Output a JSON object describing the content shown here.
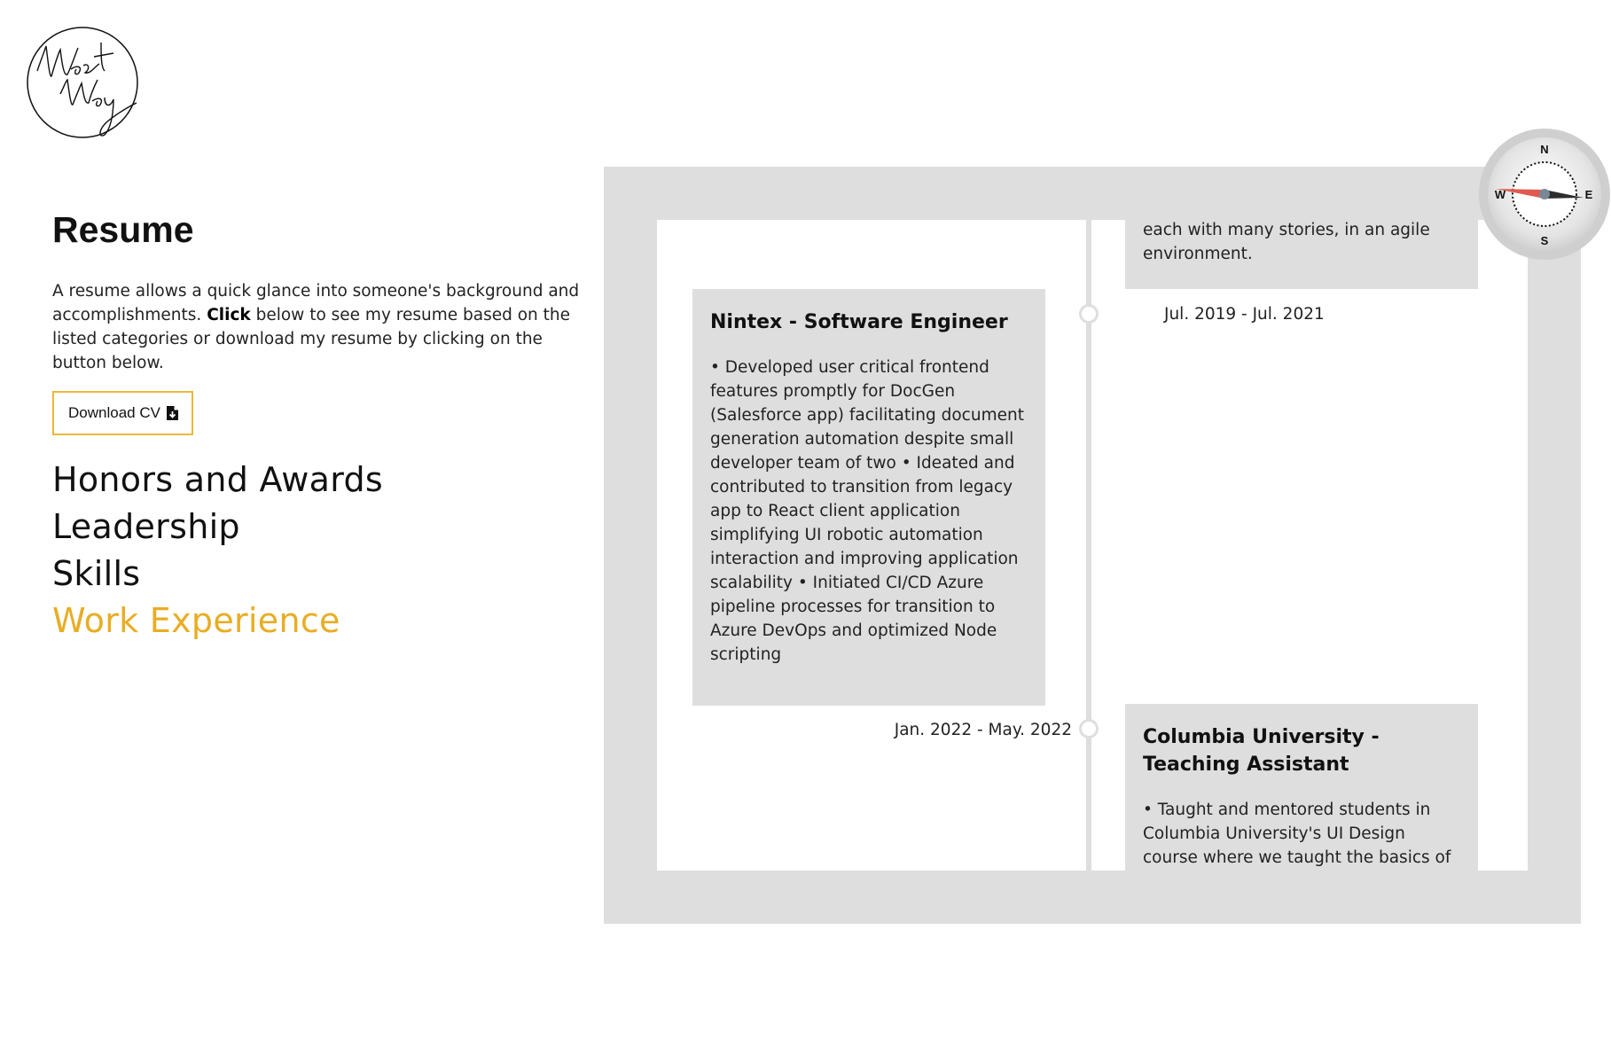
{
  "logo": {
    "alt": "West Way signature logo"
  },
  "resume": {
    "title": "Resume",
    "intro_before": "A resume allows a quick glance into someone's background and accomplishments. ",
    "intro_bold": "Click",
    "intro_after": " below to see my resume based on the listed categories or download my resume by clicking on the button below.",
    "download_label": "Download CV",
    "download_icon": "file-download-icon",
    "categories": [
      "Honors and Awards",
      "Leadership",
      "Skills",
      "Work Experience"
    ],
    "active_category": "Work Experience"
  },
  "timeline": {
    "top_card_text": "each with many stories, in an agile environment.",
    "entries": [
      {
        "title": "Nintex - Software Engineer",
        "date": "Jul. 2019 - Jul. 2021",
        "text": "• Developed user critical frontend features promptly for DocGen (Salesforce app) facilitating document generation automation despite small developer team of two • Ideated and contributed to transition from legacy app to React client application simplifying UI robotic automation interaction and improving application scalability • Initiated CI/CD Azure pipeline processes for transition to Azure DevOps and optimized Node scripting"
      },
      {
        "title": "Columbia University - Teaching Assistant",
        "date": "Jan. 2022 - May. 2022",
        "text": "• Taught and mentored students in Columbia University's UI Design course where we taught the basics of UI Design"
      }
    ]
  },
  "compass": {
    "n": "N",
    "e": "E",
    "s": "S",
    "w": "W",
    "icon": "compass-icon"
  },
  "colors": {
    "accent": "#e8ad24",
    "frame": "#dedede",
    "needle_red": "#e05a50"
  }
}
